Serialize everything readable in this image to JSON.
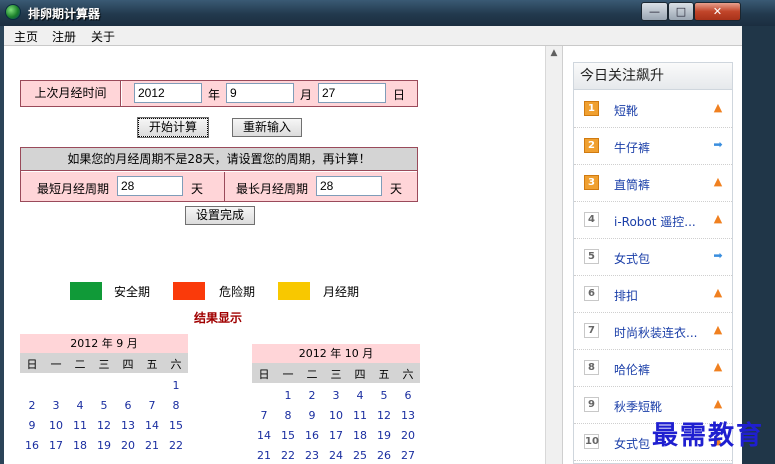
{
  "window": {
    "title": "排卵期计算器",
    "minimize_glyph": "—",
    "maximize_glyph": "□",
    "close_glyph": "✕"
  },
  "menu": [
    "主页",
    "注册",
    "关于"
  ],
  "last_period": {
    "label": "上次月经时间",
    "year": "2012",
    "year_unit": "年",
    "month": "9",
    "month_unit": "月",
    "day": "27",
    "day_unit": "日"
  },
  "buttons": {
    "calculate": "开始计算",
    "reset": "重新输入",
    "settings_done": "设置完成"
  },
  "cycle": {
    "notice": "如果您的月经周期不是28天，请设置您的周期，再计算！",
    "shortest_label": "最短月经周期",
    "shortest_value": "28",
    "shortest_unit": "天",
    "longest_label": "最长月经周期",
    "longest_value": "28",
    "longest_unit": "天"
  },
  "legend": [
    {
      "label": "安全期",
      "color": "#109a38"
    },
    {
      "label": "危险期",
      "color": "#fa3a0a"
    },
    {
      "label": "月经期",
      "color": "#f8c800"
    }
  ],
  "result_title": "结果显示",
  "weekdays": [
    "日",
    "一",
    "二",
    "三",
    "四",
    "五",
    "六"
  ],
  "calendars": [
    {
      "header": "2012 年 9 月",
      "year": 2012,
      "month": 9
    },
    {
      "header": "2012 年 10 月",
      "year": 2012,
      "month": 10
    }
  ],
  "trending": {
    "title": "今日关注飙升",
    "items": [
      {
        "rank": "1",
        "name": "短靴",
        "trend": "up"
      },
      {
        "rank": "2",
        "name": "牛仔裤",
        "trend": "flat"
      },
      {
        "rank": "3",
        "name": "直筒裤",
        "trend": "up"
      },
      {
        "rank": "4",
        "name": "i-Robot 遥控...",
        "trend": "up"
      },
      {
        "rank": "5",
        "name": "女式包",
        "trend": "flat"
      },
      {
        "rank": "6",
        "name": "排扣",
        "trend": "up"
      },
      {
        "rank": "7",
        "name": "时尚秋装连衣...",
        "trend": "up"
      },
      {
        "rank": "8",
        "name": "哈伦裤",
        "trend": "up"
      },
      {
        "rank": "9",
        "name": "秋季短靴",
        "trend": "up"
      },
      {
        "rank": "10",
        "name": "女式包",
        "trend": "up"
      }
    ]
  },
  "watermark": "最需教育"
}
